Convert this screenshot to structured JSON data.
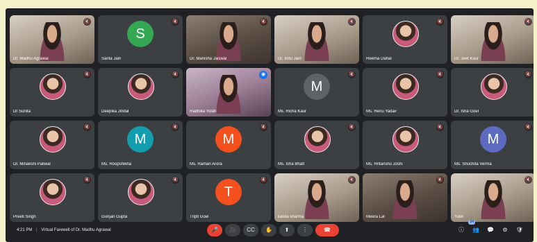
{
  "meeting": {
    "time": "4:21 PM",
    "separator": "|",
    "title": "Virtual Farewell of Dr. Madhu Agrawal"
  },
  "participants": [
    {
      "name": "Dr. Madhu Agrawal",
      "kind": "video",
      "tone": "light"
    },
    {
      "name": "Sarita Jain",
      "kind": "initial",
      "initial": "S",
      "color": "#34a853"
    },
    {
      "name": "Dr. Manisha Jaiswal",
      "kind": "video",
      "tone": "dark"
    },
    {
      "name": "Dr. Indu Jain",
      "kind": "video",
      "tone": "light"
    },
    {
      "name": "Reema Dahal",
      "kind": "photo"
    },
    {
      "name": "Dr. Jeet Kaur",
      "kind": "video",
      "tone": "light"
    },
    {
      "name": "Dr Sunita",
      "kind": "photo"
    },
    {
      "name": "Deepika Jindal",
      "kind": "photo"
    },
    {
      "name": "Radhika Yolah",
      "kind": "active"
    },
    {
      "name": "Ms. Richa Kaur",
      "kind": "initial",
      "initial": "M",
      "color": "#5f6368"
    },
    {
      "name": "Ms. Renu Yadav",
      "kind": "photo"
    },
    {
      "name": "Dr. Isha Goel",
      "kind": "photo"
    },
    {
      "name": "Dr. Minakshi Paliwal",
      "kind": "photo"
    },
    {
      "name": "Ms. Roopshikha",
      "kind": "initial",
      "initial": "M",
      "color": "#129eaf"
    },
    {
      "name": "Ms. Raman Arora",
      "kind": "initial",
      "initial": "M",
      "color": "#f4511e"
    },
    {
      "name": "Ms. Isha Bhatt",
      "kind": "photo"
    },
    {
      "name": "Ms. Hritanshu Joshi",
      "kind": "photo"
    },
    {
      "name": "Ms. Shuchita Verma",
      "kind": "initial",
      "initial": "M",
      "color": "#5c6bc0"
    },
    {
      "name": "Preeti Singh",
      "kind": "photo"
    },
    {
      "name": "Gunjan Gupta",
      "kind": "photo"
    },
    {
      "name": "Tripti Goel",
      "kind": "initial",
      "initial": "T",
      "color": "#f4511e"
    },
    {
      "name": "kavita sharma",
      "kind": "video",
      "tone": "light"
    },
    {
      "name": "Meera Lal",
      "kind": "video",
      "tone": "dark"
    },
    {
      "name": "Yukti",
      "kind": "video",
      "tone": "light"
    }
  ],
  "controls": {
    "mic": "🎤",
    "camera": "🎥",
    "captions": "CC",
    "hand": "✋",
    "present": "⬆",
    "more": "⋮",
    "end": "☎"
  },
  "right_controls": {
    "info": "ⓘ",
    "people": "👥",
    "chat": "💬",
    "activities": "⚙",
    "host": "🛡",
    "people_count": "24"
  },
  "icons": {
    "mute": "🔇",
    "speaking": "◉"
  }
}
